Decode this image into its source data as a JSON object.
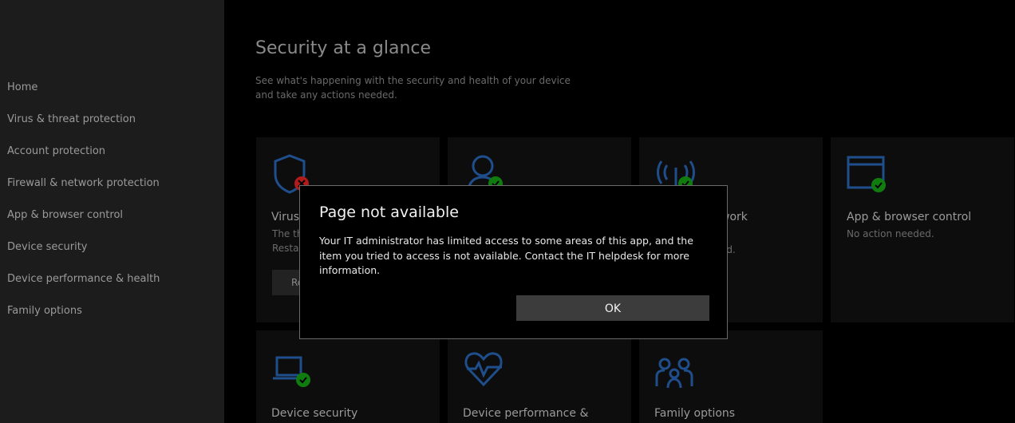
{
  "sidebar": {
    "items": [
      {
        "label": "Home"
      },
      {
        "label": "Virus & threat protection"
      },
      {
        "label": "Account protection"
      },
      {
        "label": "Firewall & network protection"
      },
      {
        "label": "App & browser control"
      },
      {
        "label": "Device security"
      },
      {
        "label": "Device performance & health"
      },
      {
        "label": "Family options"
      }
    ]
  },
  "main": {
    "title": "Security at a glance",
    "subtitle": "See what's happening with the security and health of your device and take any actions needed.",
    "tiles": [
      {
        "icon": "shield-icon",
        "title": "Virus",
        "sub_line1": "The th",
        "sub_line2": "Restar",
        "button": "Re",
        "status": "error"
      },
      {
        "icon": "person-icon",
        "title": "",
        "status": "ok"
      },
      {
        "icon": "wifi-icon",
        "title": "work",
        "sub_line1": "ed.",
        "status": "ok"
      },
      {
        "icon": "browser-window-icon",
        "title": "App & browser control",
        "sub_line1": "No action needed.",
        "status": "ok"
      },
      {
        "icon": "laptop-icon",
        "title": "Device security",
        "status": "ok"
      },
      {
        "icon": "heart-pulse-icon",
        "title": "Device performance &"
      },
      {
        "icon": "family-icon",
        "title": "Family options"
      }
    ]
  },
  "dialog": {
    "title": "Page not available",
    "body": "Your IT administrator has limited access to some areas of this app, and the item you tried to access is not available. Contact the IT helpdesk for more information.",
    "ok_label": "OK"
  },
  "colors": {
    "icon_blue": "#1f4e8c",
    "ok_green": "#107c10",
    "error_red": "#b01b1b"
  }
}
